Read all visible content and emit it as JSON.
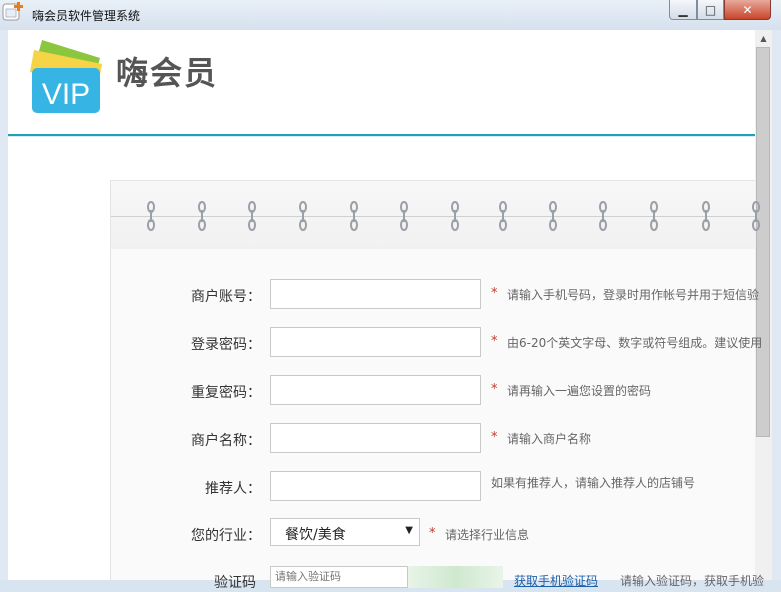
{
  "window": {
    "title": "嗨会员软件管理系统",
    "minimize_icon": "minimize-icon",
    "maximize_icon": "maximize-icon",
    "close_icon": "close-icon"
  },
  "header": {
    "logo_text": "VIP",
    "brand": "嗨会员"
  },
  "colors": {
    "accent": "#23a0b5",
    "required_star": "#c0392b",
    "link": "#1a5fa8"
  },
  "form": {
    "account": {
      "label": "商户账号：",
      "hint": "请输入手机号码，登录时用作帐号并用于短信验"
    },
    "password": {
      "label": "登录密码：",
      "hint": "由6-20个英文字母、数字或符号组成。建议使用"
    },
    "confirm_password": {
      "label": "重复密码：",
      "hint": "请再输入一遍您设置的密码"
    },
    "merchant_name": {
      "label": "商户名称：",
      "hint": "请输入商户名称"
    },
    "referrer": {
      "label": "推荐人：",
      "hint": "如果有推荐人，请输入推荐人的店铺号"
    },
    "industry": {
      "label": "您的行业：",
      "selected": "餐饮/美食",
      "hint": "请选择行业信息"
    },
    "captcha": {
      "label": "验证码",
      "placeholder": "请输入验证码",
      "link": "获取手机验证码",
      "hint": "请输入验证码，获取手机验"
    },
    "required_mark": "*"
  }
}
